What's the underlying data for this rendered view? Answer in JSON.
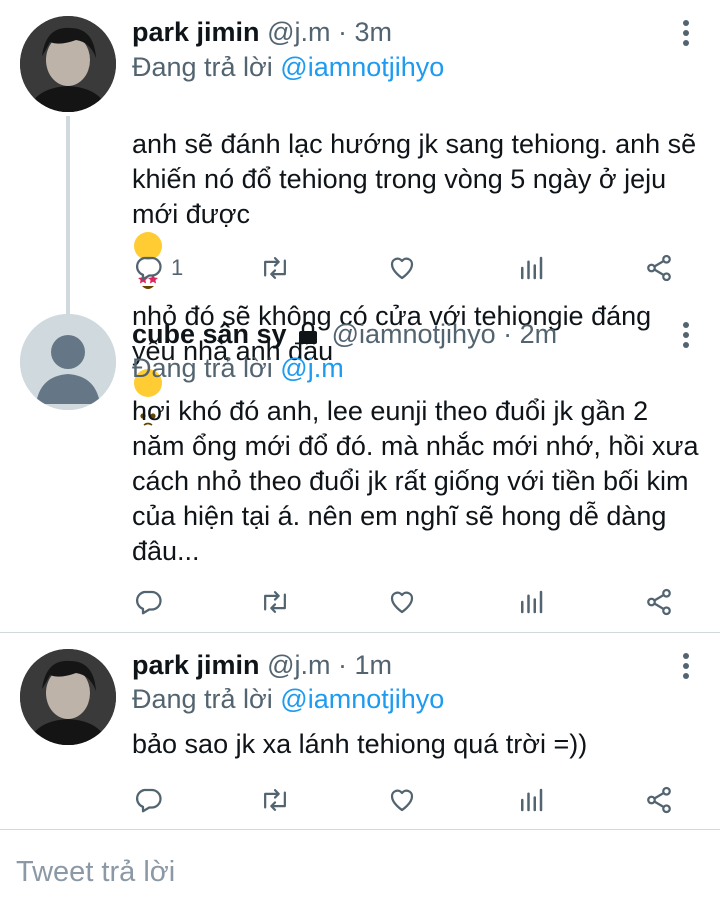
{
  "tweets": [
    {
      "name": "park jimin",
      "handle": "@j.m",
      "time": "3m",
      "replying_prefix": "Đang trả lời",
      "replying_to": "@iamnotjihyo",
      "text_a": "anh sẽ đánh lạc hướng jk sang tehiong. anh sẽ khiến nó đổ tehiong trong vòng 5 ngày ở jeju mới được",
      "text_b": "nhỏ đó sẽ không có cửa với tehiongie đáng yêu nhà anh đâu",
      "emoji_1": "star-struck-emoji",
      "emoji_2": "pleading-face-emoji",
      "reply_count": "1"
    },
    {
      "name": "cube sân sy",
      "handle": "@iamnotjihyo",
      "time": "2m",
      "replying_prefix": "Đang trả lời",
      "replying_to": "@j.m",
      "text": "hơi khó đó anh, lee eunji theo đuổi jk gần 2 năm ổng mới đổ đó. mà nhắc mới nhớ, hồi xưa cách nhỏ theo đuổi jk rất giống với tiền bối kim của hiện tại á. nên em nghĩ sẽ hong dễ dàng đâu...",
      "protected_icon": "lock-icon"
    },
    {
      "name": "park jimin",
      "handle": "@j.m",
      "time": "1m",
      "replying_prefix": "Đang trả lời",
      "replying_to": "@iamnotjihyo",
      "text": "bảo sao jk xa lánh tehiong quá trời =))"
    }
  ],
  "compose": {
    "placeholder": "Tweet trả lời"
  },
  "colors": {
    "accent": "#1d9bf0",
    "secondary_text": "#536471",
    "divider": "#cfd9de"
  }
}
